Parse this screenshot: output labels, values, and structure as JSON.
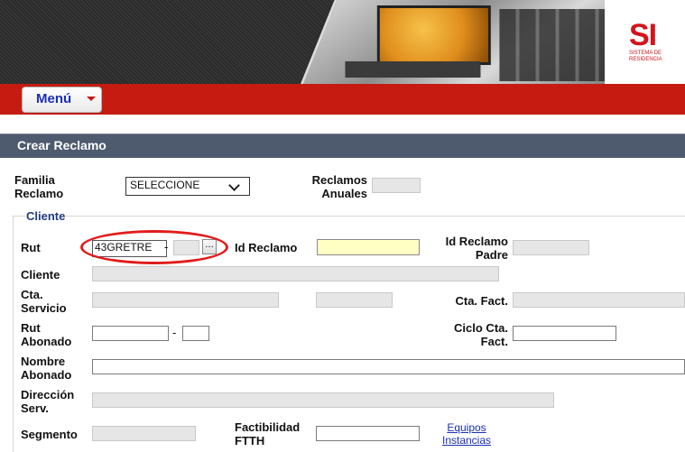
{
  "header": {
    "logo_text": "SI",
    "logo_subtitle": "SISTEMA DE RESIDENCIA"
  },
  "menu": {
    "label": "Menú"
  },
  "panel": {
    "title": "Crear Reclamo"
  },
  "form": {
    "familia_reclamo_label": "Familia Reclamo",
    "familia_reclamo_value": "SELECCIONE",
    "reclamos_anuales_label": "Reclamos Anuales",
    "reclamos_anuales_value": ""
  },
  "cliente_section": {
    "legend": "Cliente",
    "rut_label": "Rut",
    "rut_value": "43GRETRE",
    "rut_dash": "-",
    "rut_dv_value": "",
    "search_button": "...",
    "id_reclamo_label": "Id Reclamo",
    "id_reclamo_value": "",
    "id_reclamo_padre_label": "Id Reclamo Padre",
    "id_reclamo_padre_value": "",
    "cliente_label": "Cliente",
    "cliente_value": "",
    "cta_servicio_label": "Cta. Servicio",
    "cta_servicio_value": "",
    "cta_servicio_extra_value": "",
    "cta_fact_label": "Cta. Fact.",
    "cta_fact_value": "",
    "rut_abonado_label": "Rut Abonado",
    "rut_abonado_value": "",
    "rut_abonado_dash": "-",
    "rut_abonado_dv_value": "",
    "ciclo_cta_fact_label": "Ciclo Cta. Fact.",
    "ciclo_cta_fact_value": "",
    "nombre_abonado_label": "Nombre Abonado",
    "nombre_abonado_value": "",
    "direccion_serv_label": "Dirección Serv.",
    "direccion_serv_value": "",
    "segmento_label": "Segmento",
    "segmento_value": "",
    "factibilidad_ftth_label": "Factibilidad FTTH",
    "factibilidad_ftth_value": "",
    "equipos_instancias_link": "Equipos Instancias"
  },
  "colors": {
    "menu_bar": "#c51b10",
    "panel_header": "#4e5a6e",
    "highlight": "#e21b1b",
    "link": "#1a2fb4"
  }
}
